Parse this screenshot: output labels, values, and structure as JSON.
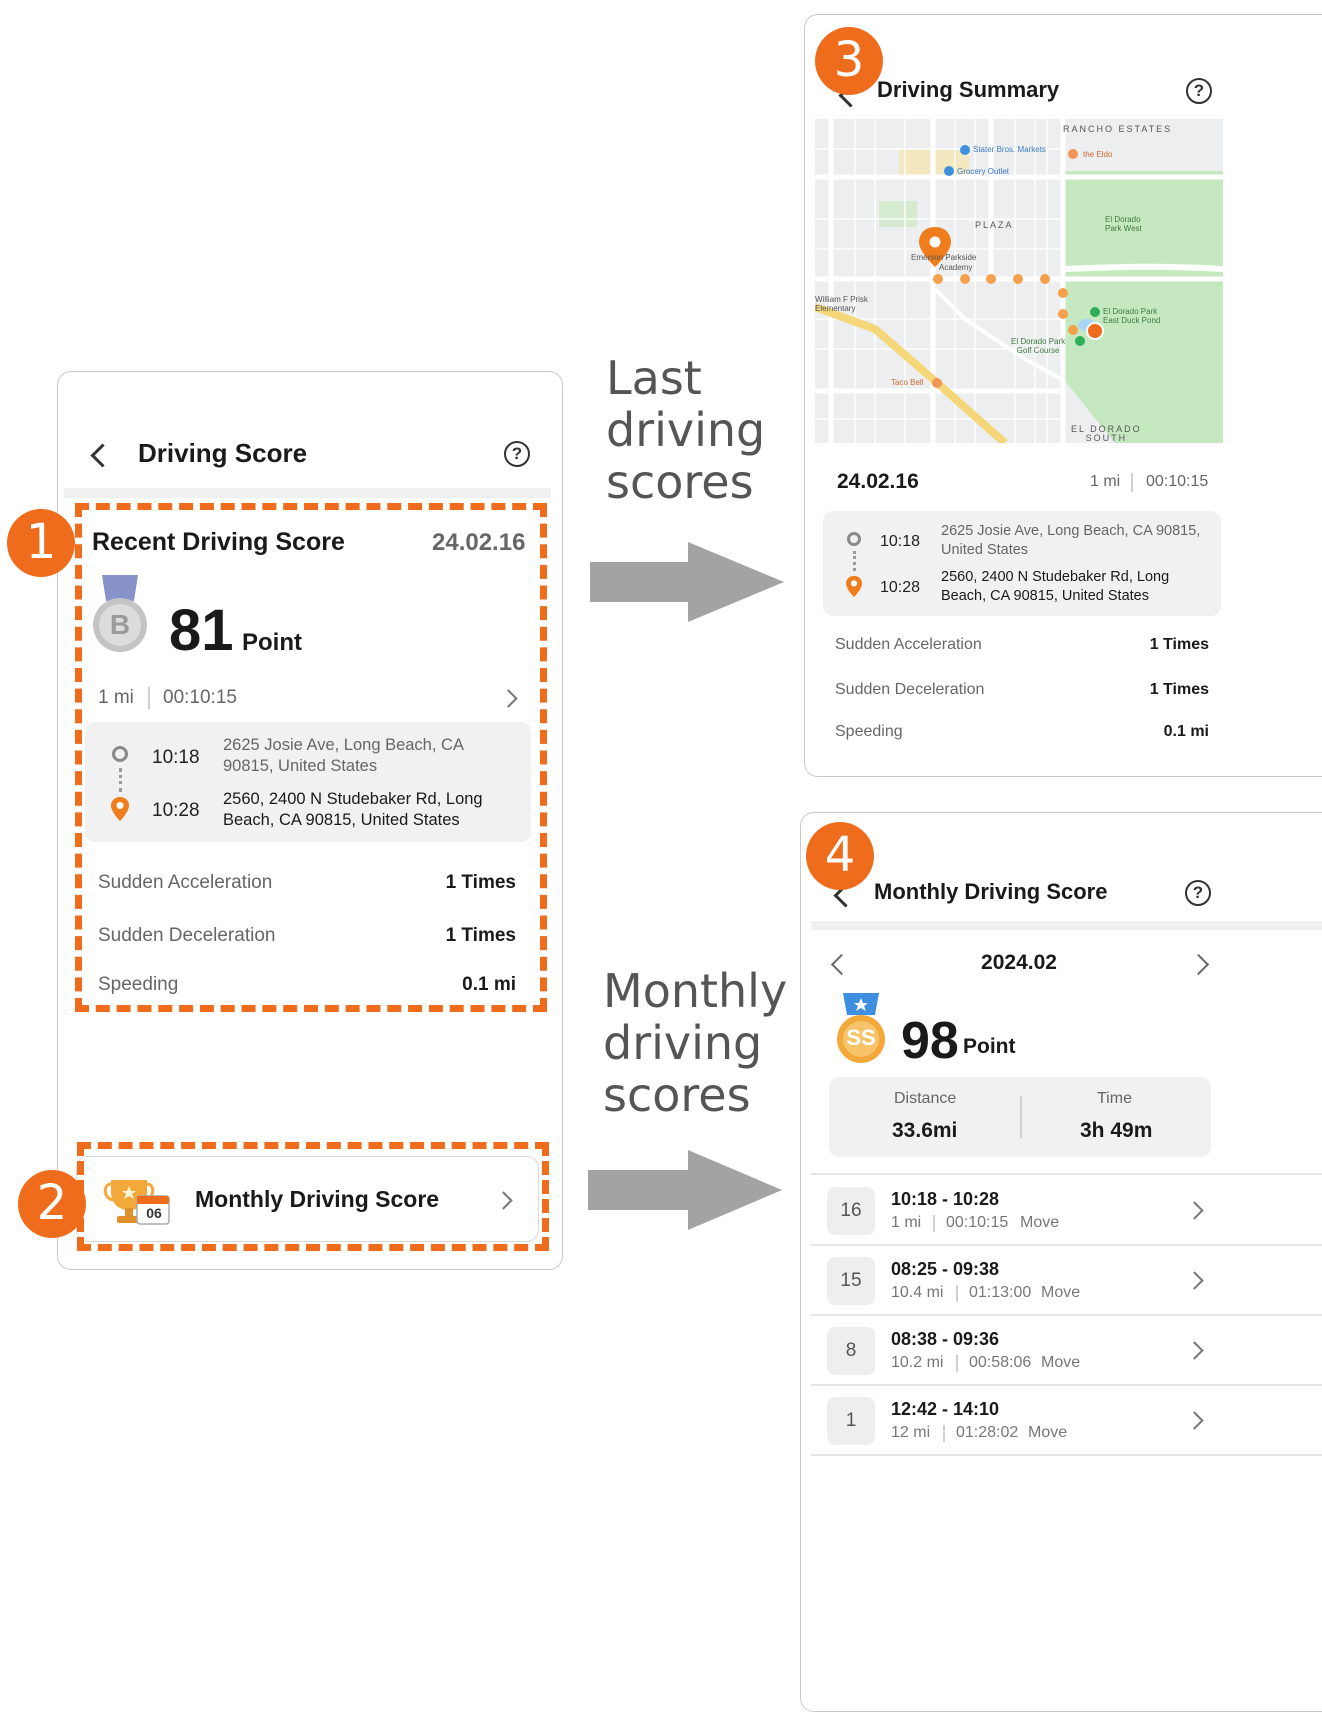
{
  "captions": {
    "last": [
      "Last",
      "driving",
      "scores"
    ],
    "monthly": [
      "Monthly",
      "driving",
      "scores"
    ]
  },
  "badges": [
    "1",
    "2",
    "3",
    "4"
  ],
  "screen1": {
    "title": "Driving Score",
    "help": "?",
    "recent_title": "Recent Driving Score",
    "date": "24.02.16",
    "grade": "B",
    "score": "81",
    "score_unit": "Point",
    "distance": "1 mi",
    "duration": "00:10:15",
    "start_time": "10:18",
    "start_address": [
      "2625 Josie Ave, Long Beach,  CA",
      "90815, United States"
    ],
    "end_time": "10:28",
    "end_address": [
      "2560, 2400 N Studebaker Rd, Long",
      "Beach, CA 90815, United States"
    ],
    "stats": [
      {
        "label": "Sudden Acceleration",
        "value": "1 Times"
      },
      {
        "label": "Sudden Deceleration",
        "value": "1 Times"
      },
      {
        "label": "Speeding",
        "value": "0.1 mi"
      }
    ],
    "monthly_button": "Monthly Driving Score",
    "trophy_day": "06"
  },
  "screen3": {
    "title": "Driving Summary",
    "help": "?",
    "date": "24.02.16",
    "distance": "1 mi",
    "duration": "00:10:15",
    "start_time": "10:18",
    "start_address": [
      "2625 Josie Ave, Long Beach,  CA 90815,",
      "United States"
    ],
    "end_time": "10:28",
    "end_address": [
      "2560, 2400 N Studebaker Rd, Long",
      "Beach, CA 90815, United States"
    ],
    "stats": [
      {
        "label": "Sudden Acceleration",
        "value": "1 Times"
      },
      {
        "label": "Sudden Deceleration",
        "value": "1 Times"
      },
      {
        "label": "Speeding",
        "value": "0.1 mi"
      }
    ],
    "map_labels": {
      "rancho": "RANCHO ESTATES",
      "stater": "Stater Bros. Markets",
      "eldo": "the Eldo",
      "grocery": "Grocery Outlet",
      "plaza": "PLAZA",
      "park_west": "El Dorado\nPark West",
      "emerson": "Emerson Parkside",
      "academy": "Academy",
      "prisk": "William F Prisk\nElementary",
      "duck_pond": "El Dorado Park\nEast Duck Pond",
      "golf": "El Dorado Park\nGolf Course",
      "taco": "Taco Bell",
      "el_dorado": "EL DORADO\nSOUTH"
    }
  },
  "screen4": {
    "title": "Monthly Driving Score",
    "help": "?",
    "month": "2024.02",
    "grade": "SS",
    "score": "98",
    "score_unit": "Point",
    "distance_label": "Distance",
    "distance": "33.6mi",
    "time_label": "Time",
    "time": "3h 49m",
    "trips": [
      {
        "day": "16",
        "range": "10:18 - 10:28",
        "dist": "1 mi",
        "dur": "00:10:15",
        "mode": "Move"
      },
      {
        "day": "15",
        "range": "08:25 - 09:38",
        "dist": "10.4 mi",
        "dur": "01:13:00",
        "mode": "Move"
      },
      {
        "day": "8",
        "range": "08:38 - 09:36",
        "dist": "10.2 mi",
        "dur": "00:58:06",
        "mode": "Move"
      },
      {
        "day": "1",
        "range": "12:42 - 14:10",
        "dist": "12 mi",
        "dur": "01:28:02",
        "mode": "Move"
      }
    ]
  },
  "colors": {
    "accent": "#ef6c1c",
    "arrow": "#a3a3a3",
    "silver": "#c4c4c4",
    "gold": "#f3a83a",
    "map_park": "#c6e8c0",
    "map_bg": "#eceef0"
  }
}
